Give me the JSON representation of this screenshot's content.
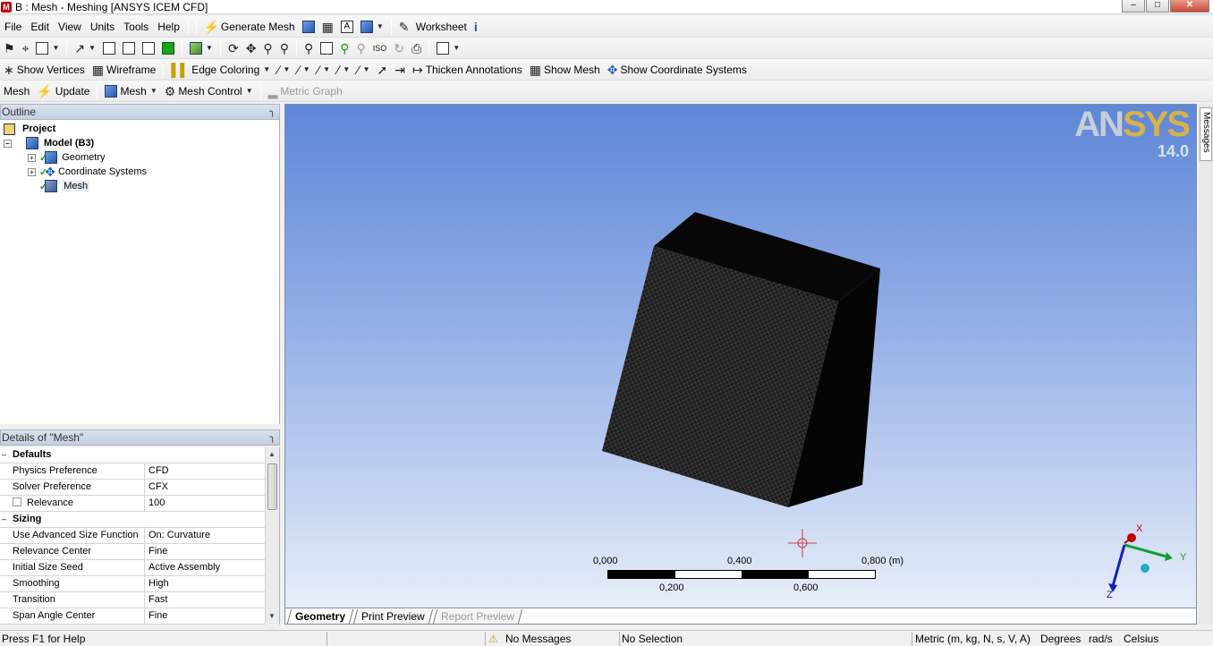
{
  "window": {
    "title": "B : Mesh - Meshing [ANSYS ICEM CFD]"
  },
  "menu": {
    "items": [
      "File",
      "Edit",
      "View",
      "Units",
      "Tools",
      "Help"
    ]
  },
  "toolbar1": {
    "generate_mesh": "Generate Mesh",
    "worksheet": "Worksheet"
  },
  "toolbar3": {
    "show_vertices": "Show Vertices",
    "wireframe": "Wireframe",
    "edge_coloring": "Edge Coloring",
    "thicken_annotations": "Thicken Annotations",
    "show_mesh": "Show Mesh",
    "show_coordinate_systems": "Show Coordinate Systems"
  },
  "toolbar4": {
    "mesh": "Mesh",
    "update": "Update",
    "mesh_menu": "Mesh",
    "mesh_control": "Mesh Control",
    "metric_graph": "Metric Graph"
  },
  "outline": {
    "title": "Outline",
    "tree": {
      "project": "Project",
      "model": "Model (B3)",
      "geometry": "Geometry",
      "coordinate_systems": "Coordinate Systems",
      "mesh": "Mesh"
    }
  },
  "details": {
    "title": "Details of \"Mesh\"",
    "groups": {
      "defaults": "Defaults",
      "sizing": "Sizing"
    },
    "rows": {
      "physics_preference": {
        "label": "Physics Preference",
        "value": "CFD"
      },
      "solver_preference": {
        "label": "Solver Preference",
        "value": "CFX"
      },
      "relevance": {
        "label": "Relevance",
        "value": "100"
      },
      "use_advanced_size_function": {
        "label": "Use Advanced Size Function",
        "value": "On: Curvature"
      },
      "relevance_center": {
        "label": "Relevance Center",
        "value": "Fine"
      },
      "initial_size_seed": {
        "label": "Initial Size Seed",
        "value": "Active Assembly"
      },
      "smoothing": {
        "label": "Smoothing",
        "value": "High"
      },
      "transition": {
        "label": "Transition",
        "value": "Fast"
      },
      "span_angle_center": {
        "label": "Span Angle Center",
        "value": "Fine"
      }
    }
  },
  "viewport": {
    "logo_text_a": "AN",
    "logo_text_b": "SYS",
    "logo_version": "14.0",
    "scale": {
      "top_labels": [
        "0,000",
        "0,400",
        "0,800 (m)"
      ],
      "bottom_labels": [
        "0,200",
        "0,600"
      ]
    },
    "triad": {
      "x": "X",
      "y": "Y",
      "z": "Z"
    }
  },
  "view_tabs": [
    "Geometry",
    "Print Preview",
    "Report Preview"
  ],
  "messages_tab": "Messages",
  "status": {
    "help": "Press F1 for Help",
    "messages": "No Messages",
    "selection": "No Selection",
    "units": "Metric (m, kg, N, s, V, A)",
    "angle": "Degrees",
    "angular_velocity": "rad/s",
    "temperature": "Celsius"
  }
}
